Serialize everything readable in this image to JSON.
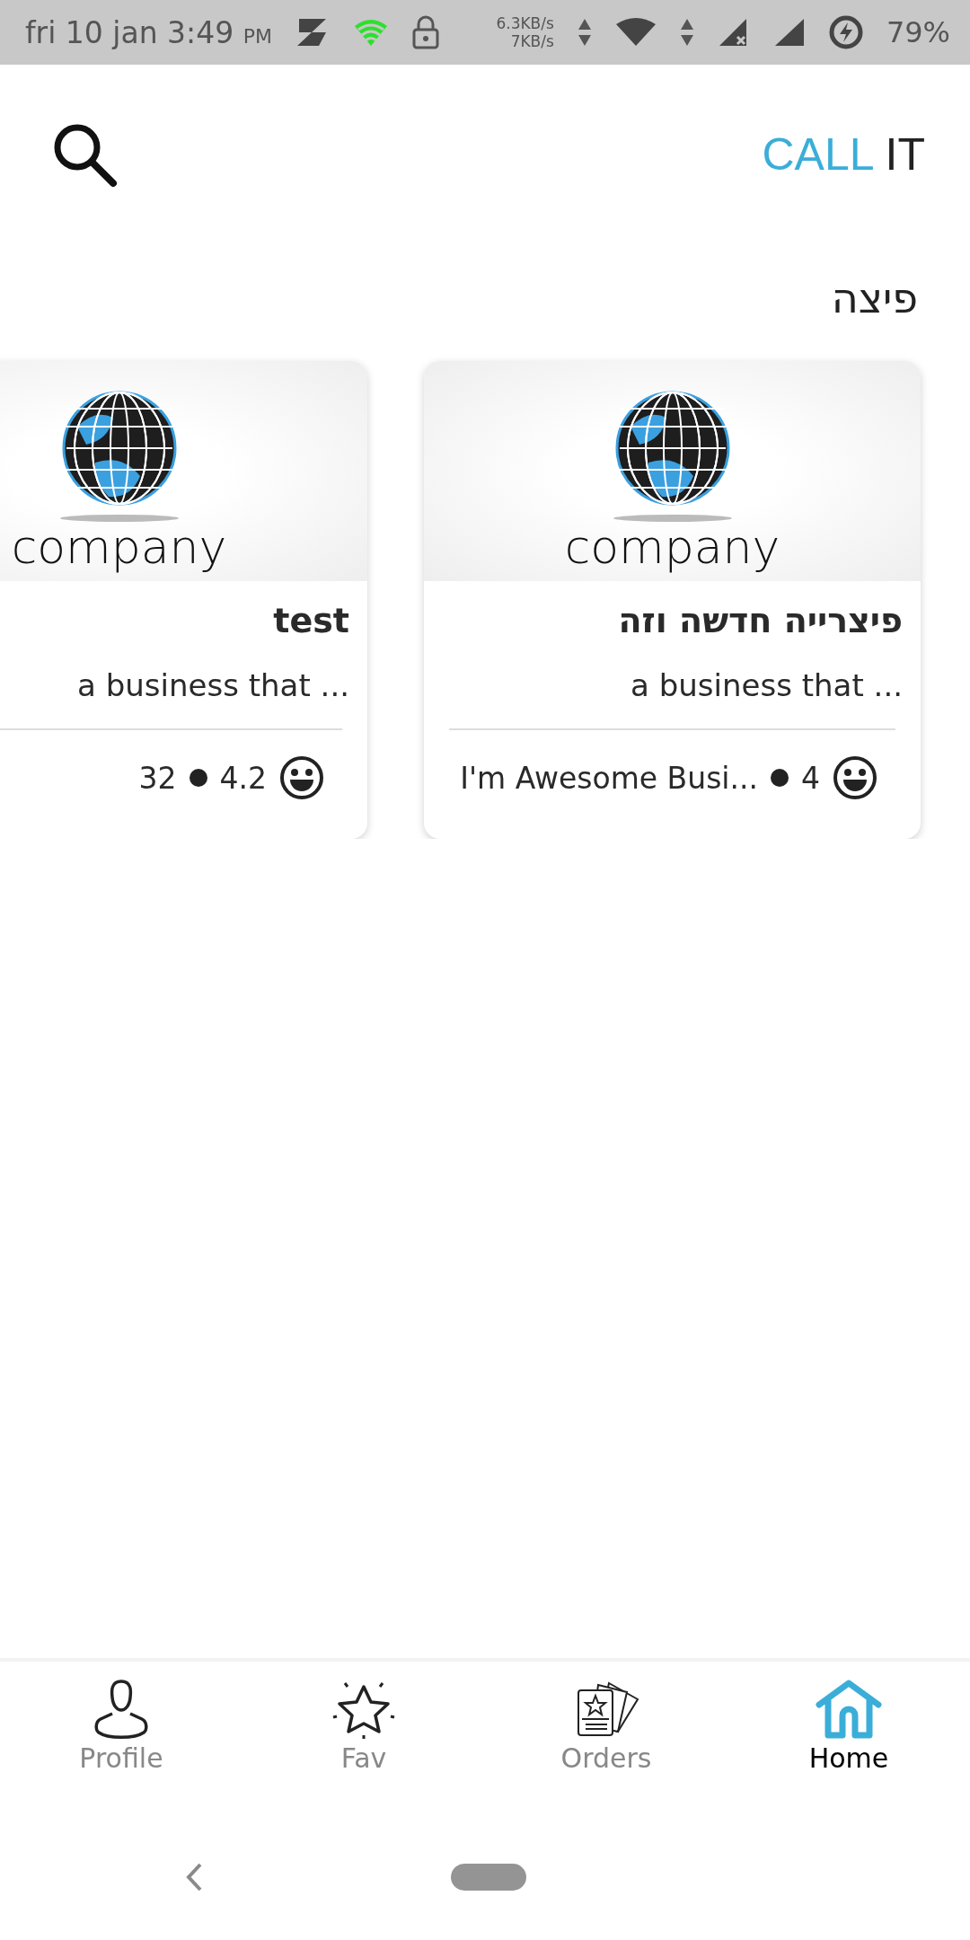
{
  "status_bar": {
    "time": "fri 10 jan 3:49",
    "ampm": "PM",
    "speed_up": "6.3KB/s",
    "speed_down": "7KB/s",
    "battery": "79%"
  },
  "header": {
    "brand_accent": "CALL",
    "brand_rest": "IT"
  },
  "section": {
    "title": "פיצה"
  },
  "cards": [
    {
      "logo_text": "company",
      "name": "test",
      "description": "a business that ...",
      "meta": "32",
      "rating": "4.2"
    },
    {
      "logo_text": "company",
      "name": "פיצרייה חדשה וזה",
      "description": "a business that ...",
      "meta": "I'm Awesome Busi...",
      "rating": "4"
    }
  ],
  "bottom_nav": [
    {
      "kind": "profile",
      "label": "Profile",
      "selected": false
    },
    {
      "kind": "fav",
      "label": "Fav",
      "selected": false
    },
    {
      "kind": "orders",
      "label": "Orders",
      "selected": false
    },
    {
      "kind": "home",
      "label": "Home",
      "selected": true
    }
  ]
}
